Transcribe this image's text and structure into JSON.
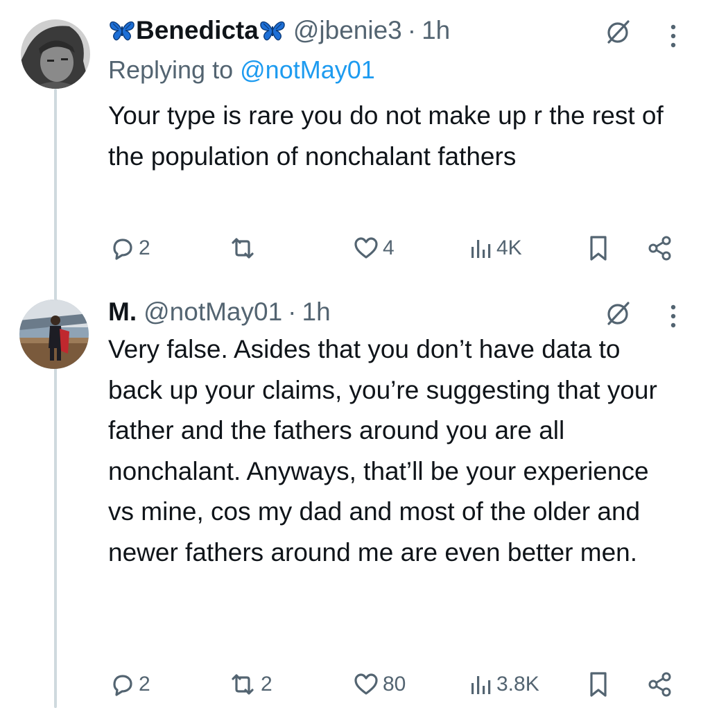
{
  "tweets": [
    {
      "display_name": "Benedicta",
      "name_emoji": "butterfly-icon",
      "handle": "@jbenie3",
      "separator": "·",
      "time": "1h",
      "reply_prefix": "Replying to",
      "reply_mention": "@notMay01",
      "text": "Your type is rare you do not make up r the rest of the population of nonchalant fathers",
      "replies": "2",
      "retweets": "",
      "likes": "4",
      "views": "4K"
    },
    {
      "display_name": "M.",
      "handle": "@notMay01",
      "separator": "·",
      "time": "1h",
      "text": "Very false. Asides that you don’t have data to back up your claims, you’re suggesting that your father and the fathers around you are all nonchalant. Anyways, that’ll be your experience vs mine, cos my dad and most of the older and newer fathers around me are even better men.",
      "replies": "2",
      "retweets": "2",
      "likes": "80",
      "views": "3.8K"
    }
  ],
  "colors": {
    "text": "#0f1419",
    "secondary": "#536471",
    "link": "#1d9bf0",
    "butterfly": "#1d6fd6",
    "thread_line": "#cfd9de"
  }
}
